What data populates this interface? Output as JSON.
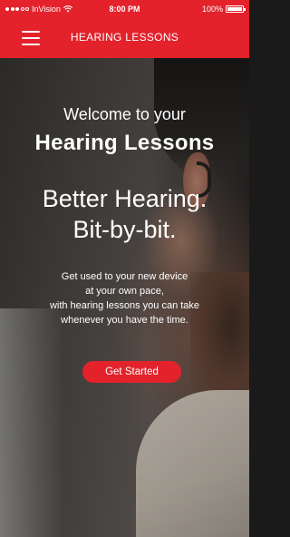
{
  "status_bar": {
    "carrier": "InVision",
    "time": "8:00 PM",
    "battery": "100%",
    "battery_level": 1.0
  },
  "nav": {
    "title": "HEARING LESSONS",
    "menu_icon": "hamburger-menu-icon"
  },
  "hero": {
    "welcome": "Welcome to your",
    "app_name": "Hearing Lessons",
    "tagline_line1": "Better Hearing.",
    "tagline_line2": "Bit-by-bit.",
    "description_lines": [
      "Get used to your new device",
      "at your own pace,",
      "with hearing lessons you can take",
      "whenever you have the time."
    ],
    "cta_label": "Get Started"
  },
  "colors": {
    "brand_red": "#e4222b",
    "text": "#ffffff"
  }
}
